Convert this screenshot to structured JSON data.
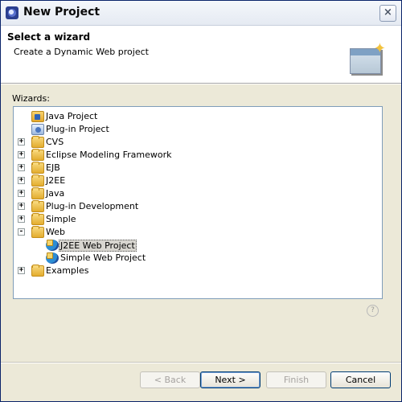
{
  "window": {
    "title": "New Project"
  },
  "header": {
    "title": "Select a wizard",
    "description": "Create a Dynamic Web project"
  },
  "wizards_label": "Wizards:",
  "tree": {
    "items": [
      {
        "label": "Java Project",
        "icon": "java-project-icon"
      },
      {
        "label": "Plug-in Project",
        "icon": "plugin-project-icon"
      },
      {
        "label": "CVS",
        "icon": "folder-icon",
        "expander": "+"
      },
      {
        "label": "Eclipse Modeling Framework",
        "icon": "folder-icon",
        "expander": "+"
      },
      {
        "label": "EJB",
        "icon": "folder-icon",
        "expander": "+"
      },
      {
        "label": "J2EE",
        "icon": "folder-icon",
        "expander": "+"
      },
      {
        "label": "Java",
        "icon": "folder-icon",
        "expander": "+"
      },
      {
        "label": "Plug-in Development",
        "icon": "folder-icon",
        "expander": "+"
      },
      {
        "label": "Simple",
        "icon": "folder-icon",
        "expander": "+"
      },
      {
        "label": "Web",
        "icon": "folder-icon",
        "expander": "-"
      },
      {
        "label": "J2EE Web Project",
        "icon": "web-project-icon",
        "selected": true
      },
      {
        "label": "Simple Web Project",
        "icon": "web-project-icon"
      },
      {
        "label": "Examples",
        "icon": "folder-icon",
        "expander": "+"
      }
    ]
  },
  "buttons": {
    "back": "< Back",
    "next": "Next >",
    "finish": "Finish",
    "cancel": "Cancel"
  },
  "help_icon": "?"
}
